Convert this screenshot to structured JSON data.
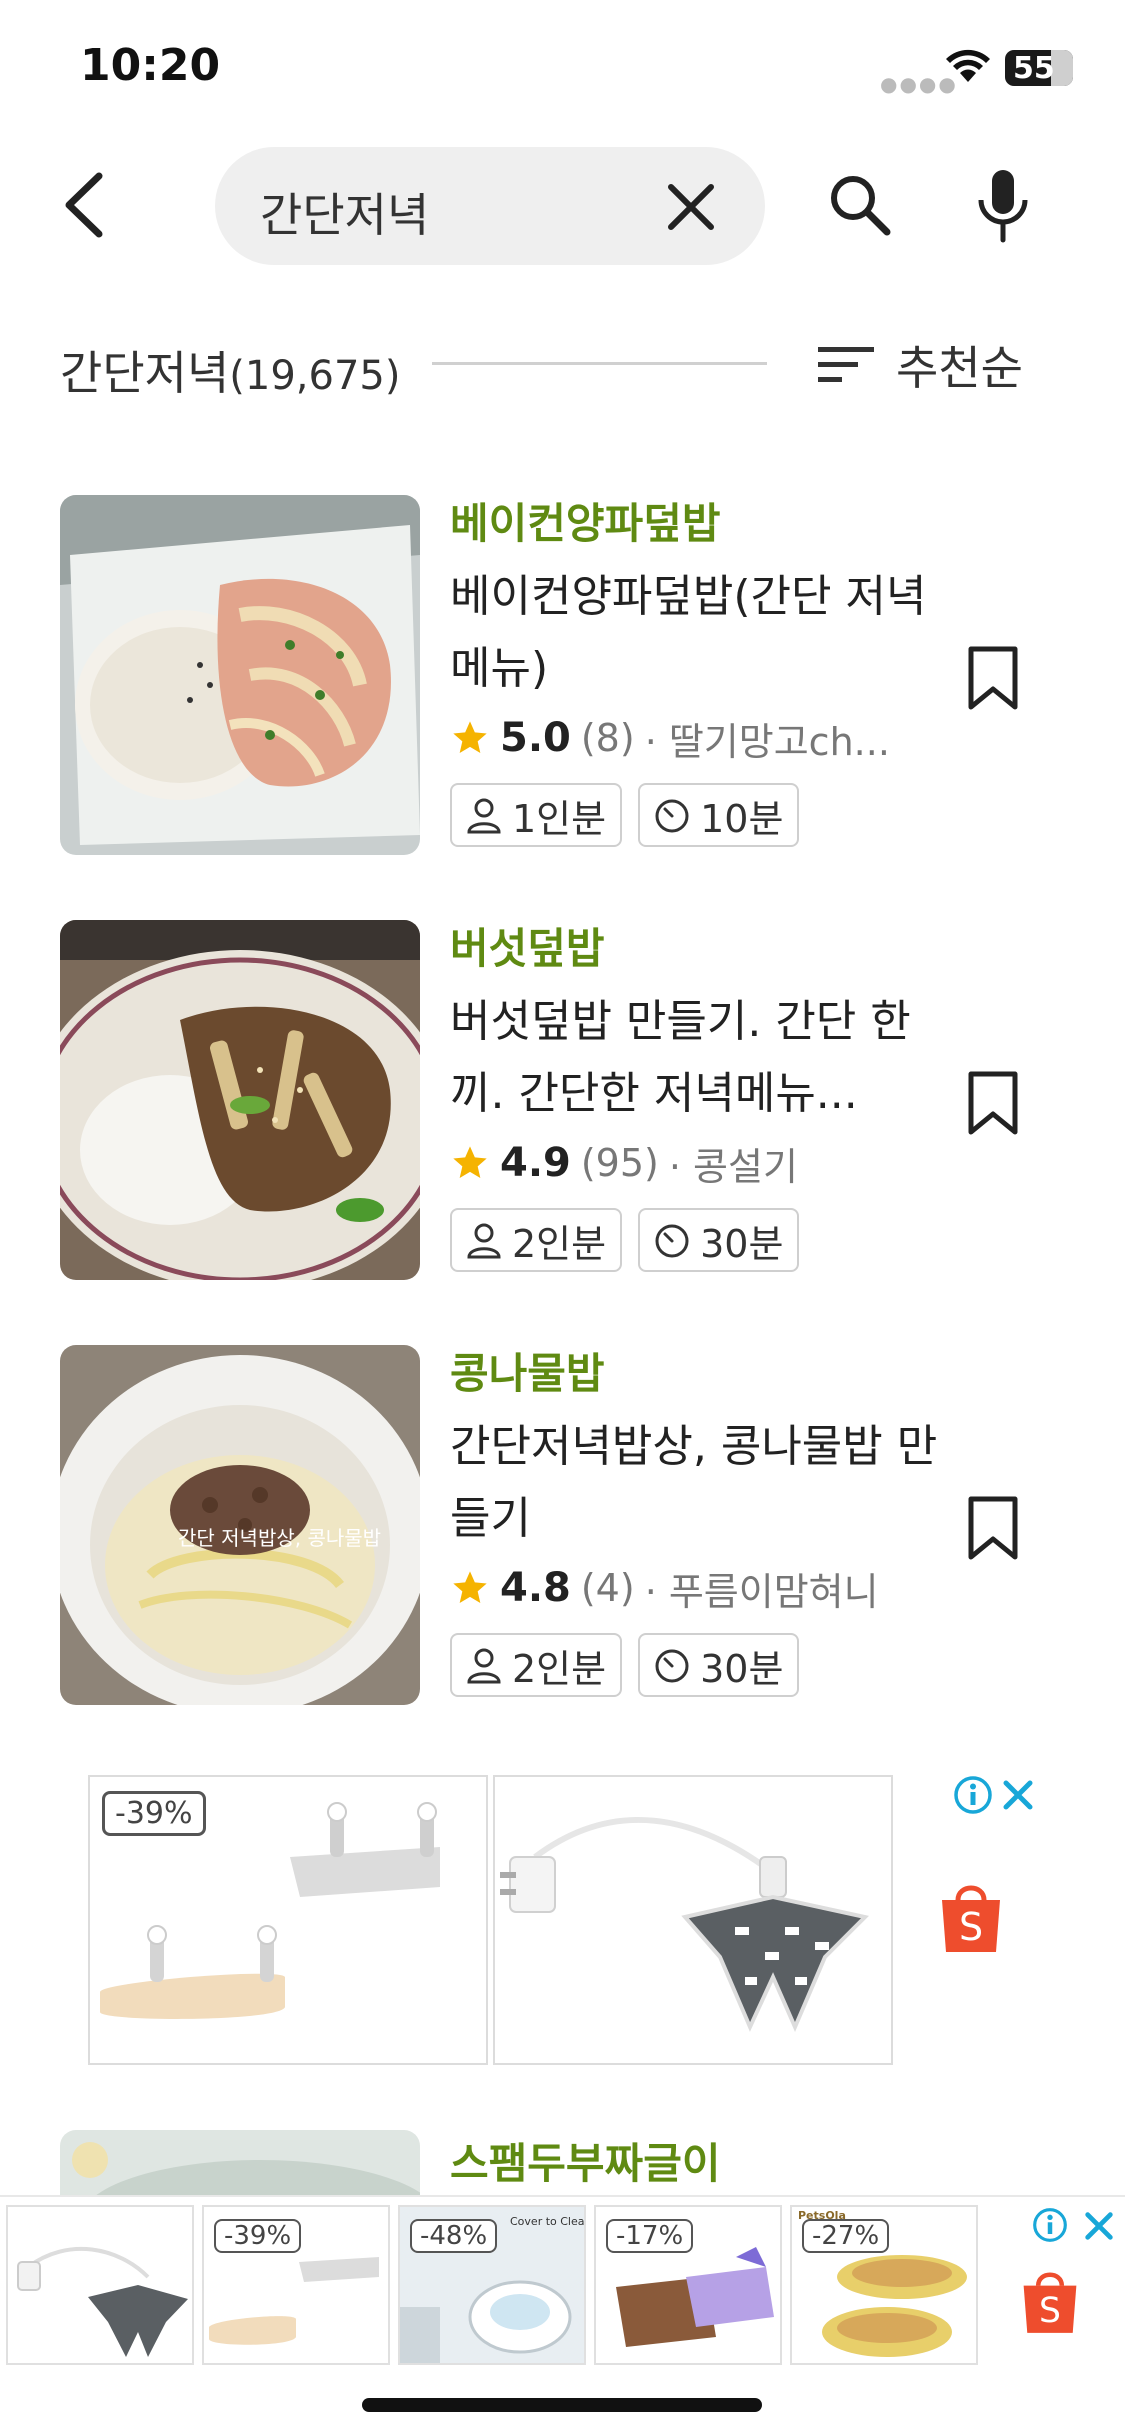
{
  "status_bar": {
    "time": "10:20",
    "battery": "55"
  },
  "search": {
    "query": "간단저녁"
  },
  "results_header": {
    "title": "간단저녁",
    "count": "(19,675)",
    "sort_label": "추천순"
  },
  "recipes": [
    {
      "category": "베이컨양파덮밥",
      "title": "베이컨양파덮밥(간단 저녁메뉴)",
      "rating": "5.0",
      "reviews": "(8)",
      "author": "· 딸기망고ch...",
      "servings": "1인분",
      "time": "10분"
    },
    {
      "category": "버섯덮밥",
      "title": "버섯덮밥 만들기. 간단 한끼. 간단한 저녁메뉴...",
      "rating": "4.9",
      "reviews": "(95)",
      "author": "· 콩설기",
      "servings": "2인분",
      "time": "30분"
    },
    {
      "category": "콩나물밥",
      "title": "간단저녁밥상, 콩나물밥 만들기",
      "rating": "4.8",
      "reviews": "(4)",
      "author": "· 푸름이맘혀니",
      "servings": "2인분",
      "time": "30분",
      "thumb_caption": "간단 저녁밥상, 콩나물밥"
    }
  ],
  "ad": {
    "discount": "-39%",
    "shop_letter": "S"
  },
  "partial_recipe": {
    "category": "스팸두부짜글이"
  },
  "bottom_banner": {
    "tiles": [
      {
        "discount": ""
      },
      {
        "discount": "-39%"
      },
      {
        "discount": "-48%",
        "caption": "Cover to Clean"
      },
      {
        "discount": "-17%"
      },
      {
        "discount": "-27%",
        "brand": "PetsOla"
      }
    ],
    "shop_letter": "S"
  },
  "colors": {
    "category_green": "#5f8a12",
    "star": "#f5b301",
    "ad_blue": "#18a7d8",
    "shop_orange": "#ee4d2d"
  }
}
